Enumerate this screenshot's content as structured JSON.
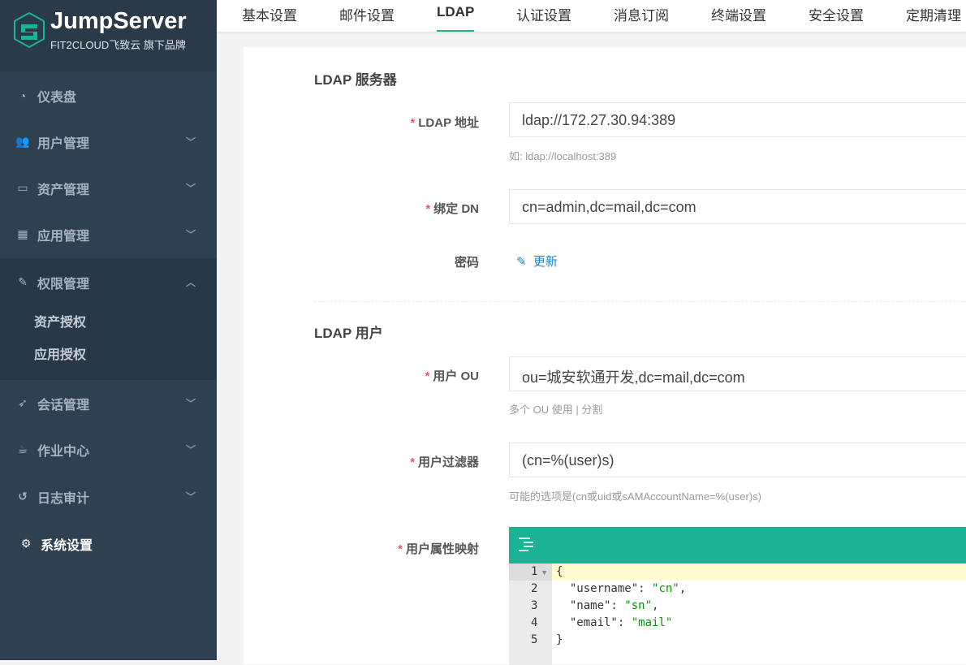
{
  "brand": {
    "name": "JumpServer",
    "tagline": "FIT2CLOUD飞致云 旗下品牌"
  },
  "sidebar": {
    "items": [
      {
        "label": "仪表盘",
        "icon": "dashboard-icon"
      },
      {
        "label": "用户管理",
        "icon": "users-icon"
      },
      {
        "label": "资产管理",
        "icon": "inbox-icon"
      },
      {
        "label": "应用管理",
        "icon": "grid-icon"
      },
      {
        "label": "权限管理",
        "icon": "edit-icon"
      },
      {
        "label": "会话管理",
        "icon": "rocket-icon"
      },
      {
        "label": "作业中心",
        "icon": "coffee-icon"
      },
      {
        "label": "日志审计",
        "icon": "history-icon"
      },
      {
        "label": "系统设置",
        "icon": "gears-icon"
      }
    ],
    "sub": [
      "资产授权",
      "应用授权"
    ]
  },
  "tabs": [
    "基本设置",
    "邮件设置",
    "LDAP",
    "认证设置",
    "消息订阅",
    "终端设置",
    "安全设置",
    "定期清理"
  ],
  "form": {
    "section1": "LDAP 服务器",
    "ldap_addr": {
      "label": "LDAP 地址",
      "value": "ldap://172.27.30.94:389",
      "help": "如: ldap://localhost:389"
    },
    "bind_dn": {
      "label": "绑定 DN",
      "value": "cn=admin,dc=mail,dc=com"
    },
    "password": {
      "label": "密码",
      "action": "更新"
    },
    "section2": "LDAP 用户",
    "user_ou": {
      "label": "用户 OU",
      "value": "ou=城安软通开发,dc=mail,dc=com",
      "help": "多个 OU 使用 | 分割"
    },
    "user_filter": {
      "label": "用户过滤器",
      "value": "(cn=%(user)s)",
      "help": "可能的选项是(cn或uid或sAMAccountName=%(user)s)"
    },
    "attr_map": {
      "label": "用户属性映射",
      "lines": [
        "{",
        "  \"username\": \"cn\",",
        "  \"name\": \"sn\",",
        "  \"email\": \"mail\"",
        "}"
      ]
    }
  },
  "colors": {
    "accent": "#1ab394",
    "sidebar": "#2f4050"
  }
}
